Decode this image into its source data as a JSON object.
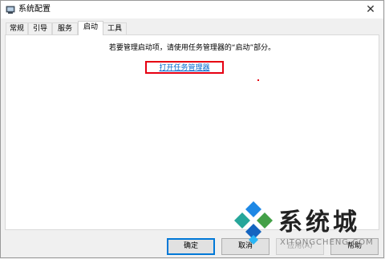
{
  "window": {
    "title": "系统配置"
  },
  "tabs": [
    {
      "label": "常规"
    },
    {
      "label": "引导"
    },
    {
      "label": "服务"
    },
    {
      "label": "启动",
      "active": true
    },
    {
      "label": "工具"
    }
  ],
  "startup": {
    "message": "若要管理启动项，请使用任务管理器的“启动”部分。",
    "link": "打开任务管理器"
  },
  "buttons": {
    "ok": "确定",
    "cancel": "取消",
    "apply": "应用(A)",
    "help": "帮助"
  },
  "watermark": {
    "text": "系统城",
    "sub": "XITONGCHENG.COM"
  },
  "colors": {
    "accent": "#0078d7",
    "link": "#0066cc",
    "highlight": "#e60012",
    "watermark_blue": "#1e88e5"
  }
}
